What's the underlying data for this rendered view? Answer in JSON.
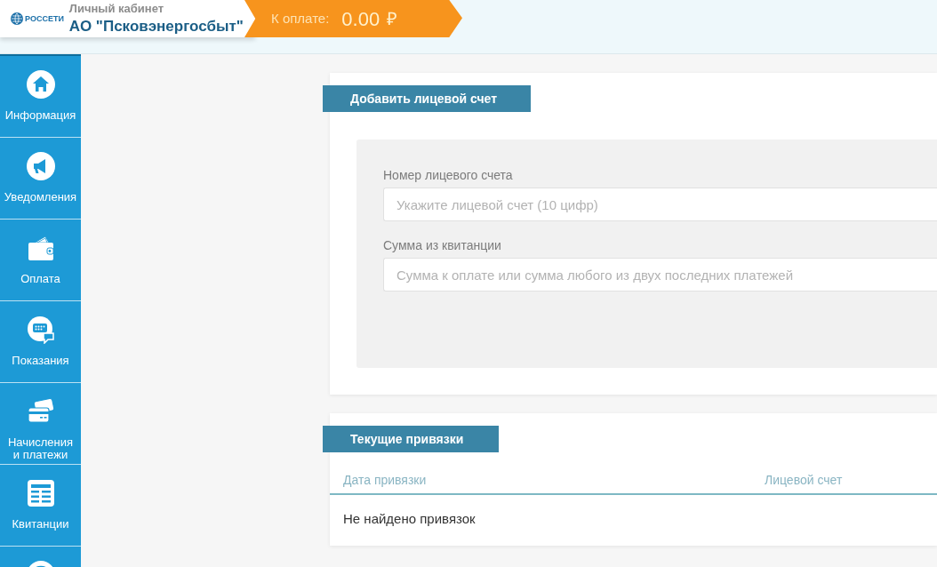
{
  "header": {
    "logo_text": "РОССЕТИ",
    "subtitle": "Личный кабинет",
    "company": "АО \"Псковэнергосбыт\"",
    "balance_label": "К оплате:",
    "balance": "0.00",
    "currency": "₽"
  },
  "sidebar": {
    "items": [
      {
        "kind": "home",
        "label": "Информация",
        "selected": false
      },
      {
        "kind": "megaphone",
        "label": "Уведомления",
        "selected": false
      },
      {
        "kind": "wallet",
        "label": "Оплата",
        "selected": false
      },
      {
        "kind": "keypad",
        "label": "Показания",
        "selected": false
      },
      {
        "kind": "cards",
        "label": "Начисления\nи платежи",
        "selected": false
      },
      {
        "kind": "table",
        "label": "Квитанции",
        "selected": false
      },
      {
        "kind": "disc",
        "selected": false
      }
    ]
  },
  "add_account": {
    "title": "Добавить лицевой счет",
    "fields": [
      {
        "label": "Номер лицевого счета",
        "placeholder": "Укажите лицевой счет (10 цифр)"
      },
      {
        "label": "Сумма из квитанции",
        "placeholder": "Сумма к оплате или сумма любого из двух последних платежей"
      }
    ]
  },
  "bindings": {
    "title": "Текущие привязки",
    "table": {
      "columns": [
        "Дата привязки",
        "Лицевой счет"
      ],
      "empty_message": "Не найдено привязок"
    }
  }
}
